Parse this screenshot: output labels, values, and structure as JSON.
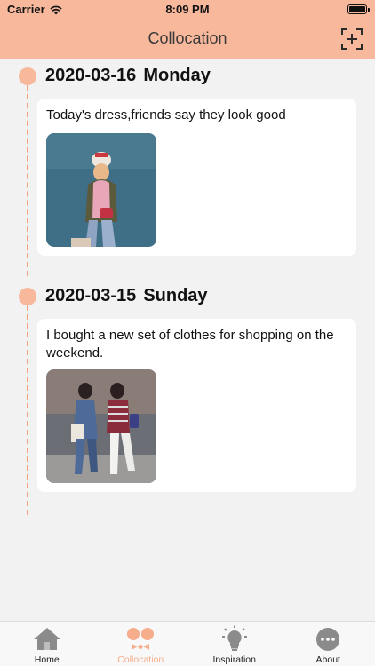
{
  "status_bar": {
    "carrier": "Carrier",
    "time": "8:09 PM",
    "battery_level": 1.0
  },
  "nav": {
    "title": "Collocation",
    "action_icon": "add-frame-icon"
  },
  "colors": {
    "accent": "#f7b89c",
    "active_tab": "#f5ad8b",
    "timeline": "#f2a27f",
    "background": "#f2f2f2"
  },
  "entries": [
    {
      "date": "2020-03-16",
      "weekday": "Monday",
      "text": "Today's dress,friends say they look good",
      "photo": "outfit-photo"
    },
    {
      "date": "2020-03-15",
      "weekday": "Sunday",
      "text": "I bought a new set of clothes for shopping on the weekend.",
      "photo": "shopping-photo"
    }
  ],
  "tabs": [
    {
      "label": "Home",
      "icon": "home-icon",
      "active": false
    },
    {
      "label": "Collocation",
      "icon": "bow-tie-icon",
      "active": true
    },
    {
      "label": "Inspiration",
      "icon": "lightbulb-icon",
      "active": false
    },
    {
      "label": "About",
      "icon": "more-icon",
      "active": false
    }
  ]
}
